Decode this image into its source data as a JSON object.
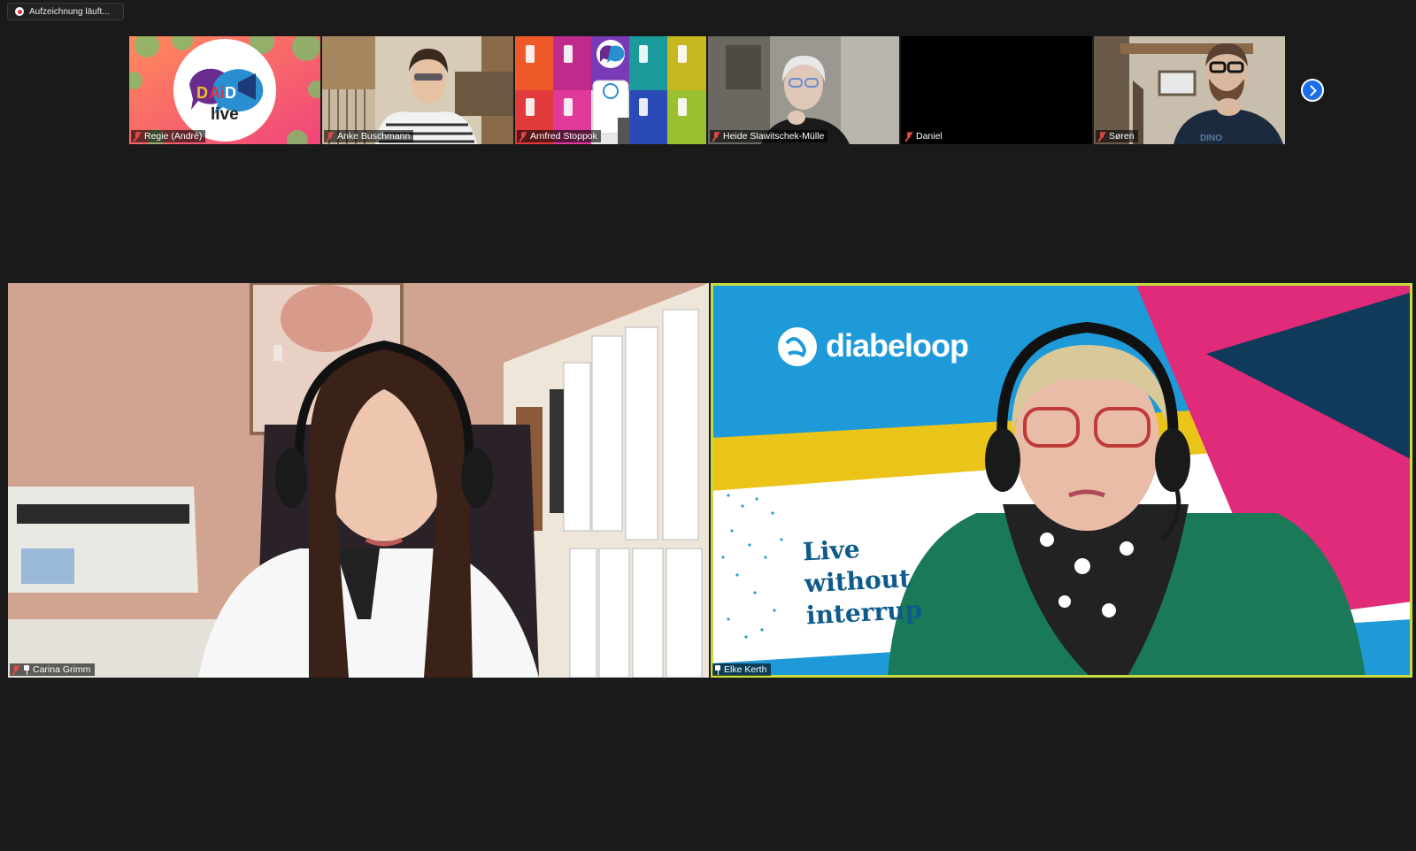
{
  "recording": {
    "label": "Aufzeichnung läuft..."
  },
  "participants": [
    {
      "name": "Regie (André)",
      "muted": true
    },
    {
      "name": "Anke Buschmann",
      "muted": true
    },
    {
      "name": "Arnfred Stoppok",
      "muted": true
    },
    {
      "name": "Heide Slawitschek-Mülle",
      "muted": true
    },
    {
      "name": "Daniel",
      "muted": true
    },
    {
      "name": "Søren",
      "muted": true
    }
  ],
  "thumbnail_logo": {
    "text": "live",
    "mark": "DiAiD"
  },
  "main_tiles": [
    {
      "name": "Carina Grimm",
      "muted": true,
      "pinned": true
    },
    {
      "name": "Elke Kerth",
      "muted": false,
      "pinned": true,
      "active_speaker": true
    }
  ],
  "background_slide": {
    "brand": "diabeloop",
    "tagline": [
      "Live",
      "without",
      "interrup"
    ]
  },
  "icons": {
    "recording": "record-icon",
    "mic": "mic-muted-icon",
    "pin": "pin-icon",
    "next": "chevron-right-icon"
  },
  "colors": {
    "background": "#1a1a1a",
    "speaker_border": "#c8dc42",
    "next_button": "#1a6ee8"
  }
}
